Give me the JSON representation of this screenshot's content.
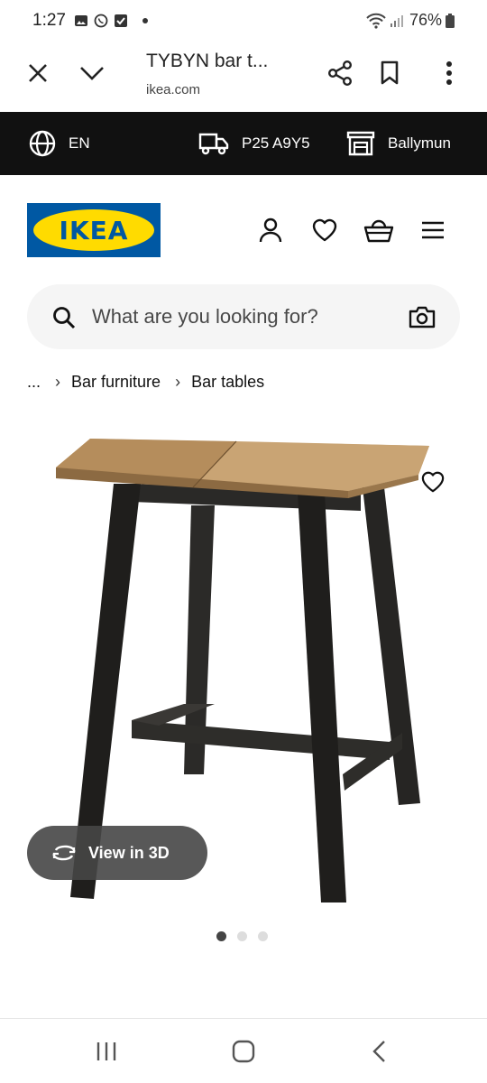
{
  "status_bar": {
    "time": "1:27",
    "battery": "76%"
  },
  "tab_bar": {
    "title": "TYBYN bar t...",
    "url": "ikea.com"
  },
  "location_bar": {
    "language": "EN",
    "postcode": "P25 A9Y5",
    "store": "Ballymun"
  },
  "header": {
    "logo_text": "IKEA"
  },
  "search": {
    "placeholder": "What are you looking for?"
  },
  "breadcrumb": {
    "ellipsis": "...",
    "items": [
      "Bar furniture",
      "Bar tables"
    ]
  },
  "product": {
    "view_3d_label": "View in 3D",
    "image_count": 3,
    "active_image": 1
  },
  "colors": {
    "ikea_blue": "#0058a3",
    "ikea_yellow": "#ffdb00",
    "location_bar_bg": "#111111"
  }
}
